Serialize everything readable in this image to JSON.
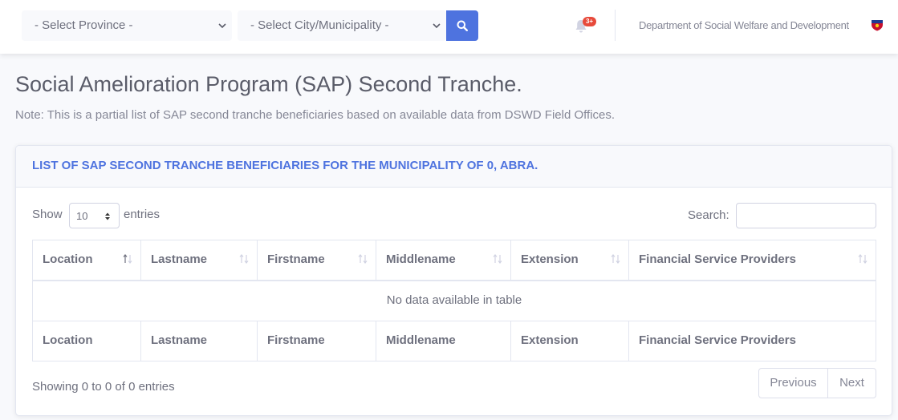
{
  "topbar": {
    "province_select": "- Select Province -",
    "city_select": "- Select City/Municipality -",
    "alerts_badge": "3+",
    "department_name": "Department of Social Welfare and Development",
    "icons": {
      "search": "search-icon",
      "bell": "bell-icon",
      "logo": "dswd-logo",
      "caret": "chevron-down-icon"
    }
  },
  "page": {
    "title": "Social Amelioration Program (SAP) Second Tranche.",
    "note": "Note: This is a partial list of SAP second tranche beneficiaries based on available data from DSWD Field Offices."
  },
  "card": {
    "header": "LIST OF SAP SECOND TRANCHE BENEFICIARIES FOR THE MUNICIPALITY OF 0, ABRA.",
    "length": {
      "show_label": "Show",
      "value": "10",
      "entries_label": "entries"
    },
    "search": {
      "label": "Search:",
      "value": ""
    },
    "table": {
      "columns": [
        "Location",
        "Lastname",
        "Firstname",
        "Middlename",
        "Extension",
        "Financial Service Providers"
      ],
      "empty_message": "No data available in table"
    },
    "info": "Showing 0 to 0 of 0 entries",
    "pagination": {
      "previous": "Previous",
      "next": "Next"
    }
  },
  "colors": {
    "primary": "#4e73df",
    "badge": "#e74a3b",
    "background": "#f8f9fc",
    "border": "#e3e6f0",
    "text": "#858796"
  }
}
